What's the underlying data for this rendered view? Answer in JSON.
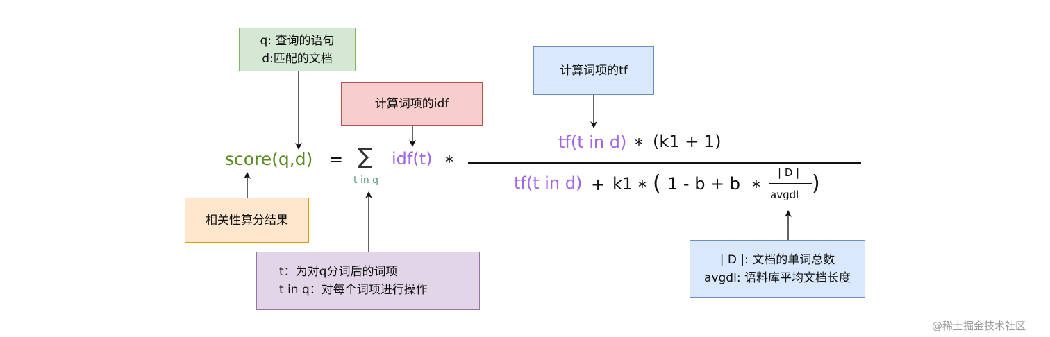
{
  "boxes": {
    "qd": {
      "line1": "q: 查询的语句",
      "line2": "d:匹配的文档"
    },
    "idf": {
      "label": "计算词项的idf"
    },
    "tf": {
      "label": "计算词项的tf"
    },
    "score_result": {
      "label": "相关性算分结果"
    },
    "terms": {
      "line1": "t：为对q分词后的词项",
      "line2": "t in q：对每个词项进行操作"
    },
    "doc_len": {
      "line1": "| D |: 文档的单词总数",
      "line2": "avgdl: 语料库平均文档长度"
    }
  },
  "formula": {
    "score": "score(q,d)",
    "equals": "=",
    "sigma": "∑",
    "sigma_sub": "t in q",
    "idf": "idf(t)",
    "times": "*",
    "num_tf": "tf(t in d)",
    "num_times": "*",
    "num_rest": "(k1 + 1)",
    "den_tf": "tf(t in d)",
    "den_plus": "+",
    "den_k1": "k1",
    "den_times": "*",
    "den_open": "(",
    "den_inner": "1 - b + b",
    "den_times2": "*",
    "frac_num": "| D |",
    "frac_den": "avgdl",
    "den_close": ")"
  },
  "watermark": "@稀土掘金技术社区"
}
